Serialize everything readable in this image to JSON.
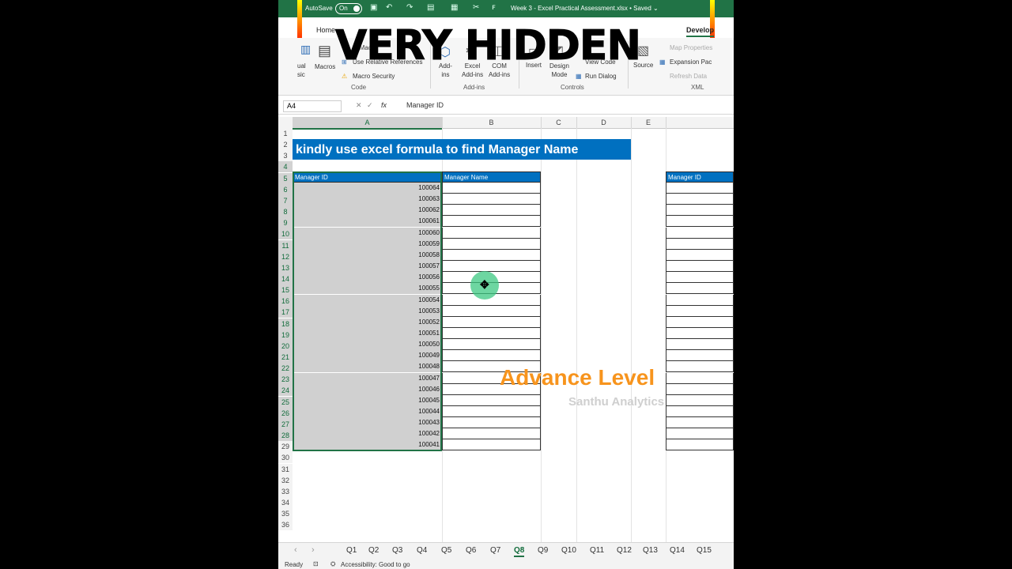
{
  "titlebar": {
    "autosave_label": "AutoSave",
    "autosave_state": "On",
    "document_title": "Week 3 - Excel Practical Assessment.xlsx • Saved ⌄"
  },
  "overlay": {
    "headline": "VERY HIDDEN",
    "level": "Advance Level",
    "brand": "Santhu Analytics"
  },
  "ribbon": {
    "tabs": [
      "Home",
      "Develop"
    ],
    "items": {
      "visual_basic": "ual\nsic",
      "macros": "Macros",
      "record_macro": "d Macro",
      "relative_refs": "Use Relative References",
      "macro_security": "Macro Security",
      "addins": "Add-\nins",
      "excel_addins": "Excel\nAdd-ins",
      "com_addins": "COM\nAdd-ins",
      "insert": "Insert",
      "design_mode": "Design\nMode",
      "properties": "Pr",
      "view_code": "View Code",
      "run_dialog": "Run Dialog",
      "source": "Source",
      "map_properties": "Map Properties",
      "expansion_packs": "Expansion Pac",
      "refresh_data": "Refresh Data"
    },
    "groups": {
      "code": "Code",
      "addins": "Add-ins",
      "controls": "Controls",
      "xml": "XML"
    }
  },
  "formula_bar": {
    "name_box": "A4",
    "fx": "fx",
    "value": "Manager ID"
  },
  "columns": [
    "A",
    "B",
    "C",
    "D",
    "E"
  ],
  "rows": [
    "1",
    "2",
    "3",
    "4",
    "5",
    "6",
    "7",
    "8",
    "9",
    "10",
    "11",
    "12",
    "13",
    "14",
    "15",
    "16",
    "17",
    "18",
    "19",
    "20",
    "21",
    "22",
    "23",
    "24",
    "25",
    "26",
    "27",
    "28",
    "29",
    "30",
    "31",
    "32",
    "33",
    "34",
    "35",
    "36"
  ],
  "sheet": {
    "banner": "kindly use excel formula to find Manager Name",
    "header_a": "Manager ID",
    "header_b": "Manager Name",
    "header_f": "Manager ID",
    "manager_ids": [
      "100064",
      "100063",
      "100062",
      "100061",
      "100060",
      "100059",
      "100058",
      "100057",
      "100056",
      "100055",
      "100054",
      "100053",
      "100052",
      "100051",
      "100050",
      "100049",
      "100048",
      "100047",
      "100046",
      "100045",
      "100044",
      "100043",
      "100042",
      "100041"
    ]
  },
  "sheet_tabs": [
    "Q1",
    "Q2",
    "Q3",
    "Q4",
    "Q5",
    "Q6",
    "Q7",
    "Q8",
    "Q9",
    "Q10",
    "Q11",
    "Q12",
    "Q13",
    "Q14",
    "Q15"
  ],
  "active_sheet": "Q8",
  "status": {
    "ready": "Ready",
    "accessibility": "Accessibility: Good to go"
  },
  "colors": {
    "excel_green": "#217346",
    "header_blue": "#0070c0",
    "level_orange": "#f7941d"
  }
}
